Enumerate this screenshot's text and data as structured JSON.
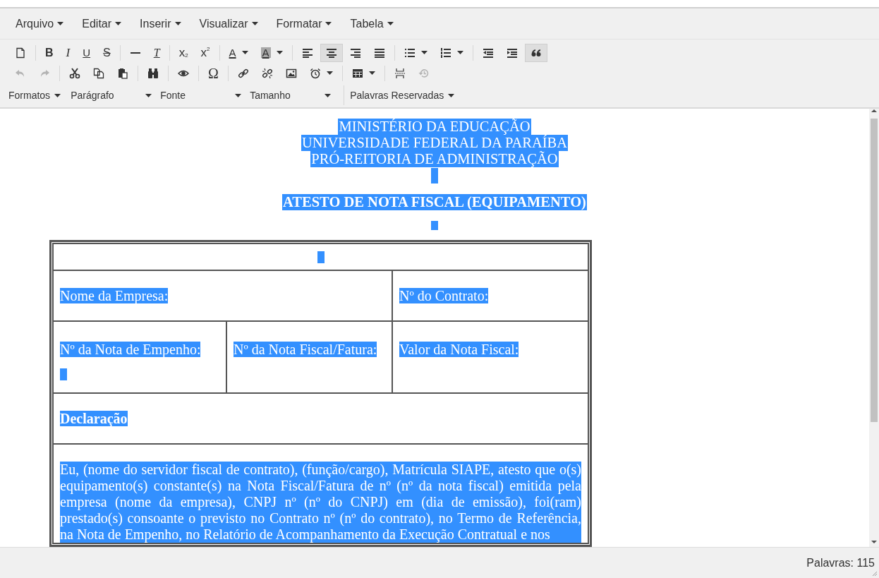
{
  "menubar": [
    "Arquivo",
    "Editar",
    "Inserir",
    "Visualizar",
    "Formatar",
    "Tabela"
  ],
  "toolbar_rows": [
    [
      [
        {
          "kind": "new-document",
          "disabled": false,
          "active": false
        }
      ],
      [
        {
          "kind": "bold",
          "glyph": "B",
          "disabled": false,
          "active": false
        },
        {
          "kind": "italic",
          "glyph": "I",
          "disabled": false,
          "active": false
        },
        {
          "kind": "underline",
          "glyph": "U",
          "disabled": false,
          "active": false
        },
        {
          "kind": "strikethrough",
          "glyph": "S",
          "disabled": false,
          "active": false
        }
      ],
      [
        {
          "kind": "horizontal-rule",
          "disabled": false,
          "active": false
        },
        {
          "kind": "clear-format",
          "glyph": "T",
          "disabled": false,
          "active": false
        }
      ],
      [
        {
          "kind": "subscript",
          "glyph": "x",
          "small": "2",
          "disabled": false,
          "active": false
        },
        {
          "kind": "superscript",
          "glyph": "x",
          "small": "2",
          "disabled": false,
          "active": false
        }
      ],
      [
        {
          "kind": "text-color",
          "glyph": "A",
          "dropdown": true,
          "disabled": false,
          "active": false
        },
        {
          "kind": "background-color",
          "glyph": "A",
          "dropdown": true,
          "disabled": false,
          "active": false
        }
      ],
      [
        {
          "kind": "align-left",
          "disabled": false,
          "active": false
        },
        {
          "kind": "align-center",
          "disabled": false,
          "active": true
        },
        {
          "kind": "align-right",
          "disabled": false,
          "active": false
        },
        {
          "kind": "justify",
          "disabled": false,
          "active": false
        }
      ],
      [
        {
          "kind": "bullet-list",
          "dropdown": true,
          "disabled": false,
          "active": false
        },
        {
          "kind": "numbered-list",
          "dropdown": true,
          "disabled": false,
          "active": false
        }
      ],
      [
        {
          "kind": "outdent",
          "disabled": false,
          "active": false
        },
        {
          "kind": "indent",
          "disabled": false,
          "active": false
        },
        {
          "kind": "blockquote",
          "disabled": false,
          "active": true
        }
      ]
    ],
    [
      [
        {
          "kind": "undo",
          "disabled": true,
          "active": false
        },
        {
          "kind": "redo",
          "disabled": true,
          "active": false
        }
      ],
      [
        {
          "kind": "cut",
          "disabled": false,
          "active": false
        },
        {
          "kind": "copy",
          "disabled": false,
          "active": false
        },
        {
          "kind": "paste",
          "disabled": false,
          "active": false
        }
      ],
      [
        {
          "kind": "find",
          "disabled": false,
          "active": false
        }
      ],
      [
        {
          "kind": "preview",
          "disabled": false,
          "active": false
        }
      ],
      [
        {
          "kind": "special-character",
          "glyph": "Ω",
          "disabled": false,
          "active": false
        }
      ],
      [
        {
          "kind": "link",
          "disabled": false,
          "active": false
        },
        {
          "kind": "unlink",
          "disabled": false,
          "active": false
        },
        {
          "kind": "image",
          "disabled": false,
          "active": false
        },
        {
          "kind": "clock",
          "dropdown": true,
          "disabled": false,
          "active": false
        }
      ],
      [
        {
          "kind": "table",
          "dropdown": true,
          "disabled": false,
          "active": false
        }
      ],
      [
        {
          "kind": "page-break",
          "disabled": false,
          "active": false
        },
        {
          "kind": "restore",
          "disabled": true,
          "active": false
        }
      ]
    ]
  ],
  "format_row": [
    [
      {
        "label": "Formatos",
        "kind": "menu"
      },
      {
        "label": "Parágrafo",
        "kind": "select"
      },
      {
        "label": "Fonte",
        "kind": "select"
      },
      {
        "label": "Tamanho",
        "kind": "select"
      }
    ],
    [
      {
        "label": "Palavras Reservadas",
        "kind": "menu"
      }
    ]
  ],
  "document": {
    "header_lines": [
      "MINISTÉRIO DA EDUCAÇÃO",
      "UNIVERSIDADE FEDERAL DA PARAÍBA",
      "PRÓ-REITORIA DE ADMINISTRAÇÃO"
    ],
    "title": "ATESTO DE NOTA FISCAL (EQUIPAMENTO)",
    "table_rows": [
      [
        {
          "text": "",
          "colspan": 3
        }
      ],
      [
        {
          "text": "Nome da Empresa:",
          "colspan": 2
        },
        {
          "text": "Nº do Contrato:"
        }
      ],
      [
        {
          "text": "Nº da Nota de Empenho:",
          "empty_line": true
        },
        {
          "text": "Nº da Nota Fiscal/Fatura:"
        },
        {
          "text": "Valor da Nota Fiscal:"
        }
      ],
      [
        {
          "text": "Declaração",
          "colspan": 3,
          "bold": true
        }
      ],
      [
        {
          "text": "Eu, (nome do servidor fiscal de contrato), (função/cargo), Matrícula SIAPE, atesto que o(s) equipamento(s) constante(s) na Nota Fiscal/Fatura de nº (nº da nota fiscal) emitida pela empresa (nome da empresa), CNPJ nº (nº do CNPJ) em (dia de emissão), foi(ram) prestado(s) consoante o previsto no Contrato nº (nº do contrato), no Termo de Referência, na Nota de Empenho, no Relatório de Acompanhamento da Execução Contratual e nos",
          "colspan": 3,
          "paragraph": true
        }
      ]
    ]
  },
  "status_bar": {
    "word_count": "Palavras: 115"
  }
}
